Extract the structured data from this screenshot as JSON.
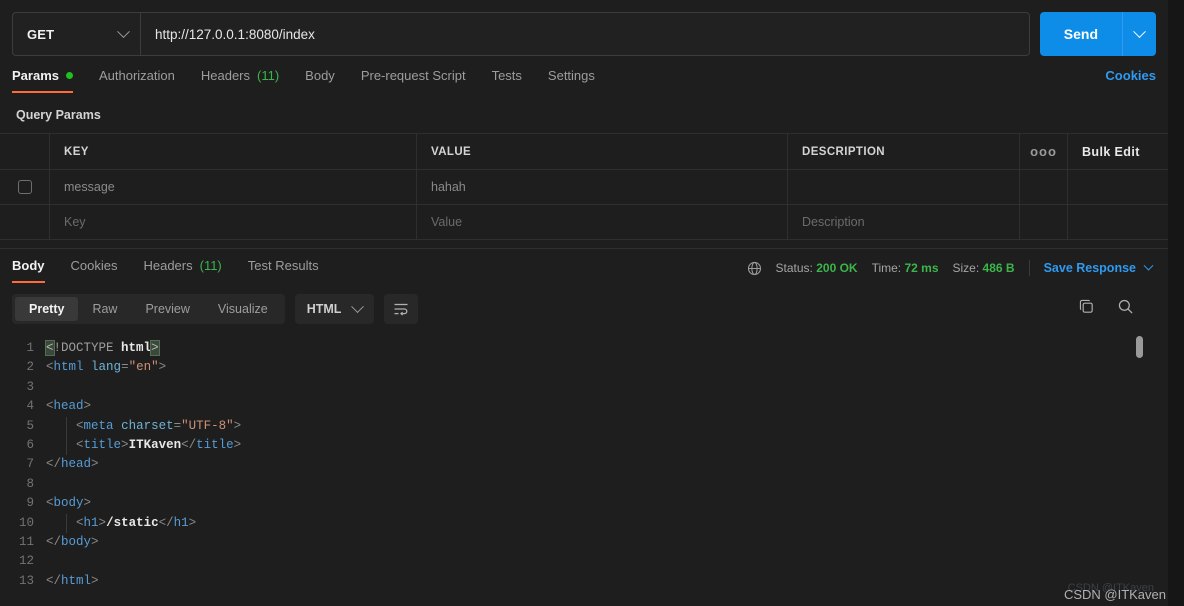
{
  "request": {
    "method": "GET",
    "url": "http://127.0.0.1:8080/index",
    "send_label": "Send",
    "tabs": [
      {
        "label": "Params",
        "badge": "",
        "indicator": "dot"
      },
      {
        "label": "Authorization",
        "badge": "",
        "indicator": ""
      },
      {
        "label": "Headers",
        "badge": "(11)",
        "indicator": ""
      },
      {
        "label": "Body",
        "badge": "",
        "indicator": ""
      },
      {
        "label": "Pre-request Script",
        "badge": "",
        "indicator": ""
      },
      {
        "label": "Tests",
        "badge": "",
        "indicator": ""
      },
      {
        "label": "Settings",
        "badge": "",
        "indicator": ""
      }
    ],
    "cookies_label": "Cookies"
  },
  "query_params": {
    "section_title": "Query Params",
    "columns": [
      "KEY",
      "VALUE",
      "DESCRIPTION"
    ],
    "dots_label": "ooo",
    "bulk_edit_label": "Bulk Edit",
    "rows": [
      {
        "key": "message",
        "value": "hahah",
        "description": "",
        "checked": false
      }
    ],
    "placeholder_row": {
      "key": "Key",
      "value": "Value",
      "description": "Description"
    }
  },
  "response": {
    "tabs": [
      {
        "label": "Body",
        "badge": ""
      },
      {
        "label": "Cookies",
        "badge": ""
      },
      {
        "label": "Headers",
        "badge": "(11)"
      },
      {
        "label": "Test Results",
        "badge": ""
      }
    ],
    "status_label": "Status:",
    "status_value": "200 OK",
    "time_label": "Time:",
    "time_value": "72 ms",
    "size_label": "Size:",
    "size_value": "486 B",
    "save_response_label": "Save Response",
    "format_tabs": [
      "Pretty",
      "Raw",
      "Preview",
      "Visualize"
    ],
    "language": "HTML"
  },
  "code": {
    "lines": [
      {
        "n": "1",
        "indent": 0,
        "guide": false
      },
      {
        "n": "2",
        "indent": 0,
        "guide": false
      },
      {
        "n": "3",
        "indent": 0,
        "guide": false
      },
      {
        "n": "4",
        "indent": 0,
        "guide": false
      },
      {
        "n": "5",
        "indent": 1,
        "guide": true
      },
      {
        "n": "6",
        "indent": 1,
        "guide": true
      },
      {
        "n": "7",
        "indent": 0,
        "guide": false
      },
      {
        "n": "8",
        "indent": 0,
        "guide": false
      },
      {
        "n": "9",
        "indent": 0,
        "guide": false
      },
      {
        "n": "10",
        "indent": 1,
        "guide": true
      },
      {
        "n": "11",
        "indent": 0,
        "guide": false
      },
      {
        "n": "12",
        "indent": 0,
        "guide": false
      },
      {
        "n": "13",
        "indent": 0,
        "guide": false
      }
    ],
    "text": [
      "<!DOCTYPE html>",
      "<html lang=\"en\">",
      "",
      "<head>",
      "    <meta charset=\"UTF-8\">",
      "    <title>ITKaven</title>",
      "</head>",
      "",
      "<body>",
      "    <h1>/static</h1>",
      "</body>",
      "",
      "</html>"
    ]
  },
  "icons": {
    "method_chevron": "chevron-down-icon",
    "send_chevron": "chevron-down-icon",
    "globe": "globe-icon",
    "wrap": "wrap-lines-icon",
    "copy": "copy-icon",
    "search": "search-icon"
  },
  "watermark": {
    "text": "CSDN @ITKaven",
    "ghost": "CSDN @ITKaven"
  },
  "colors": {
    "accent_orange": "#ff6c37",
    "accent_blue": "#0d8ce8",
    "link_blue": "#2f9af0",
    "status_green": "#3bb54a",
    "background": "#1e1e1e"
  }
}
